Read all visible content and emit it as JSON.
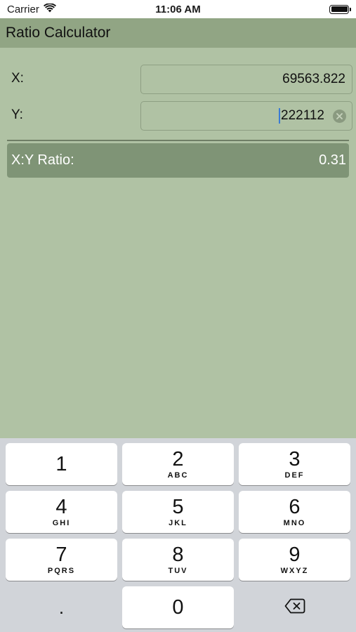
{
  "status_bar": {
    "carrier": "Carrier",
    "time": "11:06 AM"
  },
  "nav": {
    "title": "Ratio Calculator"
  },
  "form": {
    "x_label": "X:",
    "x_value": "69563.822",
    "y_label": "Y:",
    "y_value": "222112"
  },
  "result": {
    "label": "X:Y Ratio:",
    "value": "0.31"
  },
  "keyboard": {
    "keys": [
      {
        "digit": "1",
        "letters": ""
      },
      {
        "digit": "2",
        "letters": "ABC"
      },
      {
        "digit": "3",
        "letters": "DEF"
      },
      {
        "digit": "4",
        "letters": "GHI"
      },
      {
        "digit": "5",
        "letters": "JKL"
      },
      {
        "digit": "6",
        "letters": "MNO"
      },
      {
        "digit": "7",
        "letters": "PQRS"
      },
      {
        "digit": "8",
        "letters": "TUV"
      },
      {
        "digit": "9",
        "letters": "WXYZ"
      },
      {
        "digit": "0",
        "letters": ""
      }
    ],
    "decimal": "."
  },
  "icons": {
    "wifi": "wifi-icon",
    "battery": "battery-icon",
    "clear": "clear-text-icon",
    "backspace": "backspace-icon"
  },
  "colors": {
    "background": "#b0c2a4",
    "nav_bar": "#91a584",
    "result_bar": "#7f9476",
    "keyboard": "#d1d4d9"
  }
}
